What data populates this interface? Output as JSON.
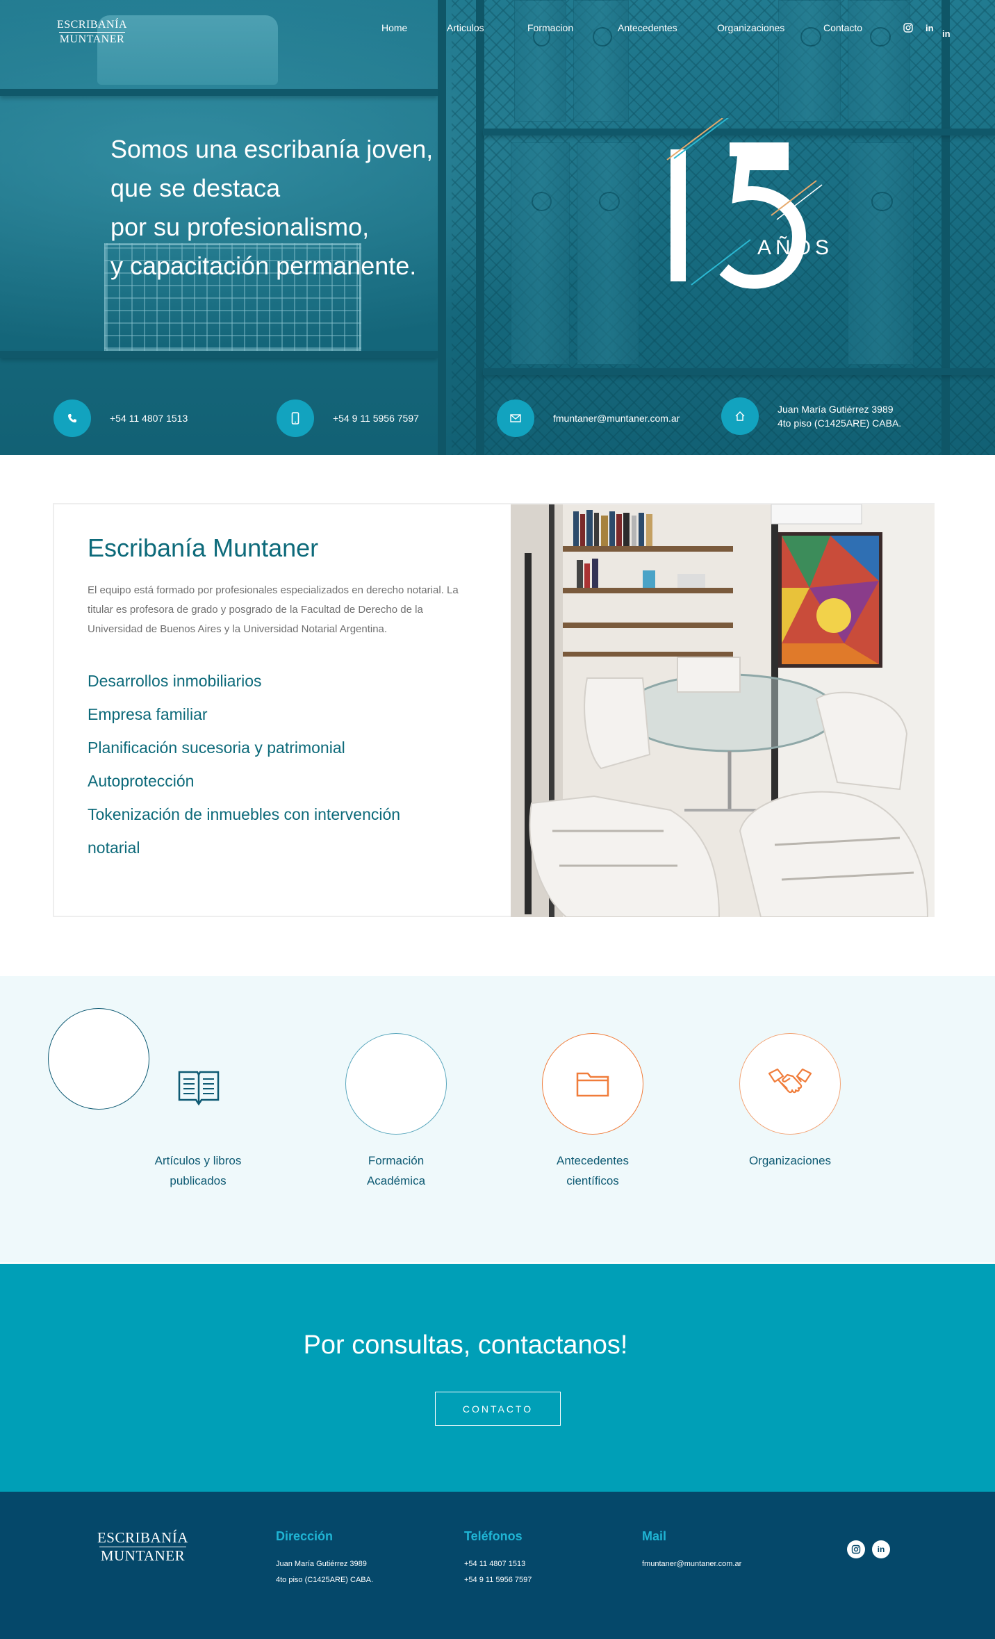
{
  "header": {
    "logo_line1": "ESCRIBANÍA",
    "logo_line2": "MUNTANER",
    "nav": [
      "Home",
      "Articulos",
      "Formacion",
      "Antecedentes",
      "Organizaciones",
      "Contacto"
    ],
    "social_icons": [
      "instagram-icon",
      "linkedin-icon",
      "linkedin-icon"
    ],
    "social_glyphs": {
      "linkedin": "in"
    }
  },
  "hero": {
    "lines": [
      "Somos una escribanía joven,",
      "que se destaca",
      "por su profesionalismo,",
      "y capacitación permanente."
    ],
    "badge_number": "15",
    "badge_text": "AÑOS"
  },
  "contact_strip": [
    {
      "icon": "phone-icon",
      "text": "+54 11 4807 1513"
    },
    {
      "icon": "mobile-icon",
      "text": "+54 9 11 5956 7597"
    },
    {
      "icon": "mail-icon",
      "text": "fmuntaner@muntaner.com.ar"
    },
    {
      "icon": "home-icon",
      "line1": "Juan María Gutiérrez 3989",
      "line2": "4to piso (C1425ARE) CABA."
    }
  ],
  "about": {
    "title": "Escribanía Muntaner",
    "description": "El equipo está formado por profesionales especializados en derecho notarial. La titular es profesora de grado y posgrado de la Facultad de Derecho de la Universidad de Buenos Aires y la Universidad Notarial Argentina.",
    "services": [
      "Desarrollos inmobiliarios",
      "Empresa familiar",
      "Planificación sucesoria y patrimonial",
      "Autoprotección",
      "Tokenización de inmuebles con intervención",
      "notarial"
    ]
  },
  "services_grid": [
    {
      "label_line1": "Artículos y libros",
      "label_line2": "publicados",
      "icon": "open-book-icon"
    },
    {
      "label_line1": "Formación",
      "label_line2": "Académica",
      "icon": ""
    },
    {
      "label_line1": "Antecedentes",
      "label_line2": "científicos",
      "icon": "folder-icon"
    },
    {
      "label_line1": "Organizaciones",
      "label_line2": "",
      "icon": "handshake-icon"
    }
  ],
  "cta": {
    "title": "Por consultas, contactanos!",
    "button": "CONTACTO"
  },
  "footer": {
    "logo_line1": "ESCRIBANÍA",
    "logo_line2": "MUNTANER",
    "direccion_title": "Dirección",
    "direccion_line1": "Juan María Gutiérrez 3989",
    "direccion_line2": "4to piso (C1425ARE) CABA.",
    "telefonos_title": "Teléfonos",
    "telefono1": "+54 11 4807 1513",
    "telefono2": "+54 9 11 5956 7597",
    "mail_title": "Mail",
    "mail": "fmuntaner@muntaner.com.ar",
    "social_icons": [
      "instagram-icon",
      "linkedin-icon"
    ]
  },
  "colors": {
    "brand_teal": "#0d6a7a",
    "accent_cyan": "#009fb7",
    "footer_navy": "#05486a",
    "orange": "#f07c3a"
  }
}
